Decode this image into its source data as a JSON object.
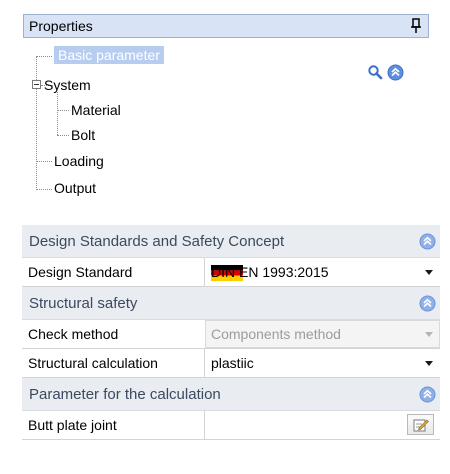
{
  "panel": {
    "title": "Properties",
    "pin_icon": "pin-icon"
  },
  "tree": {
    "items": [
      {
        "label": "Basic parameter",
        "selected": true
      },
      {
        "label": "System",
        "expanded": true
      },
      {
        "label": "Material"
      },
      {
        "label": "Bolt"
      },
      {
        "label": "Loading"
      },
      {
        "label": "Output"
      }
    ],
    "search_icon": "search-icon",
    "collapse_icon": "collapse-up-icon"
  },
  "grid": {
    "design_section": {
      "title": "Design Standards and Safety Concept"
    },
    "design_standard": {
      "name": "Design Standard",
      "value": "DIN EN 1993:2015",
      "flag": "germany-flag-icon"
    },
    "safety_section": {
      "title": "Structural safety"
    },
    "check_method": {
      "name": "Check method",
      "value": "Components method"
    },
    "structural_calc": {
      "name": "Structural calculation",
      "value": "plastiic"
    },
    "calc_section": {
      "title": "Parameter for the calculation"
    },
    "butt_plate": {
      "name": "Butt plate joint",
      "button_icon": "edit-icon"
    }
  },
  "colors": {
    "header_bg": "#d8e4f6",
    "section_bg": "#e9ecf1",
    "selected_bg": "#b7cdf0",
    "accent_blue": "#4a7fdc"
  }
}
